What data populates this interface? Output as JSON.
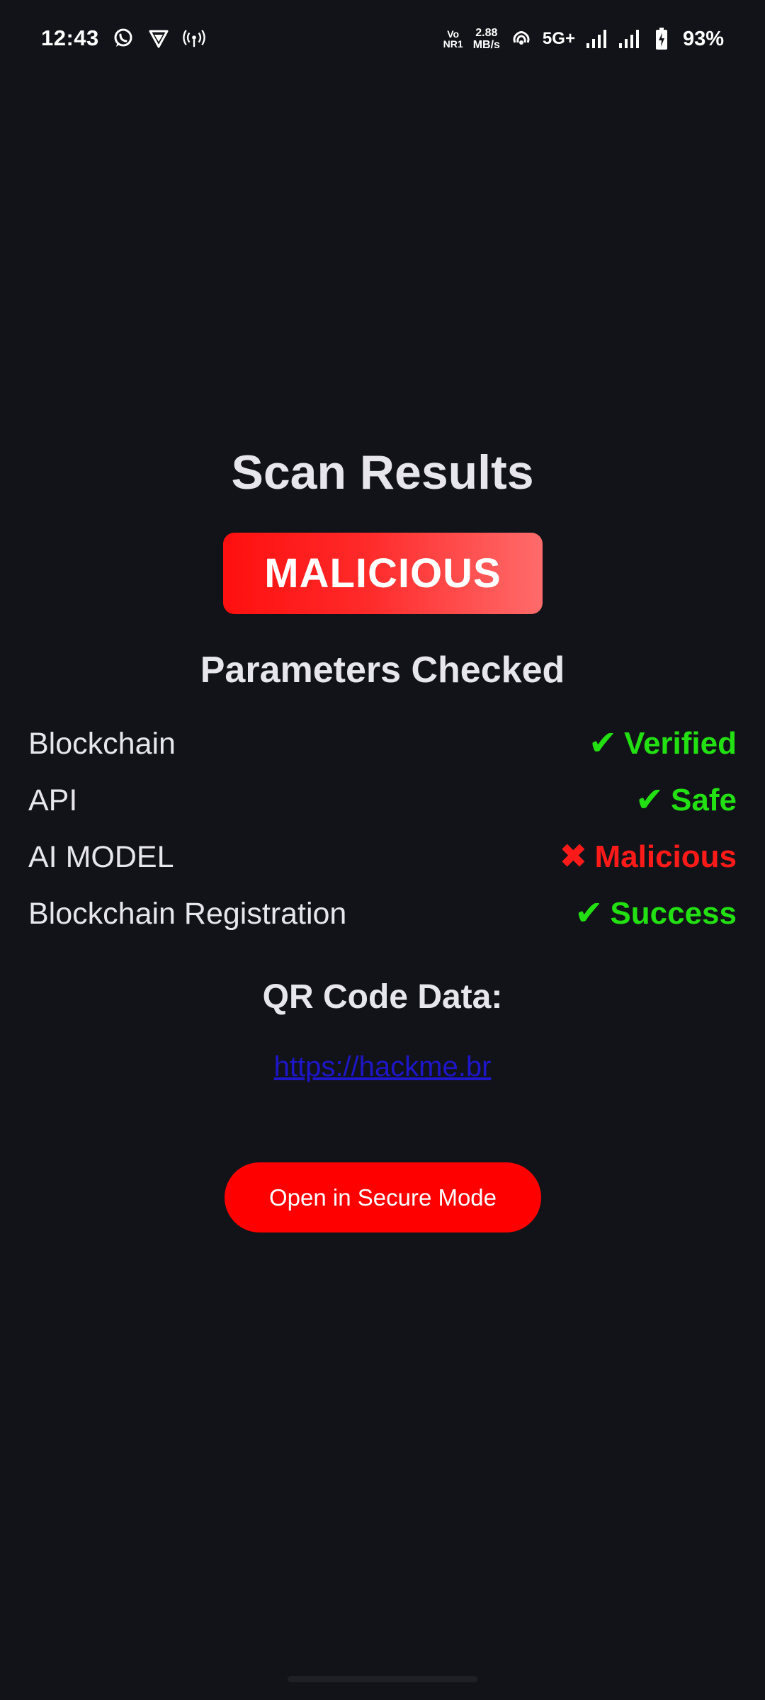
{
  "status_bar": {
    "time": "12:43",
    "left_icons": [
      "whatsapp-icon",
      "vpn-shield-icon",
      "hotspot-icon"
    ],
    "volte_top": "Vo",
    "volte_bottom": "NR1",
    "net_speed_value": "2.88",
    "net_speed_unit": "MB/s",
    "network_type": "5G+",
    "battery_percent": "93%"
  },
  "main": {
    "title": "Scan Results",
    "verdict": "MALICIOUS",
    "params_title": "Parameters Checked",
    "params": [
      {
        "label": "Blockchain",
        "status": "Verified",
        "state": "ok",
        "symbol": "✔"
      },
      {
        "label": "API",
        "status": "Safe",
        "state": "ok",
        "symbol": "✔"
      },
      {
        "label": "AI MODEL",
        "status": "Malicious",
        "state": "bad",
        "symbol": "✖"
      },
      {
        "label": "Blockchain Registration",
        "status": "Success",
        "state": "ok",
        "symbol": "✔"
      }
    ],
    "qr_title": "QR Code Data:",
    "qr_url": "https://hackme.br",
    "open_button_label": "Open in Secure Mode"
  },
  "colors": {
    "background": "#121318",
    "verdict_gradient_start": "#ff0f0f",
    "verdict_gradient_end": "#ff6b6b",
    "ok_green": "#22e012",
    "bad_red": "#ff1a1a",
    "link_blue": "#1e16c9",
    "button_red": "#ff0000"
  }
}
